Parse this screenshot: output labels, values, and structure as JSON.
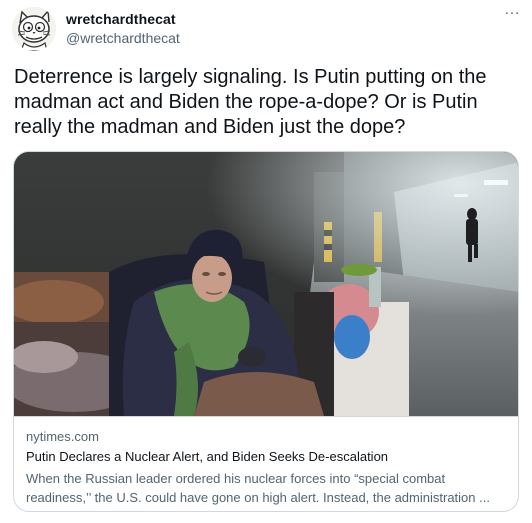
{
  "author": {
    "display_name": "wretchardthecat",
    "handle": "@wretchardthecat",
    "avatar_icon": "cartoon-cat-avatar"
  },
  "menu": {
    "more_label": "···",
    "icon": "more-horizontal-icon"
  },
  "tweet": {
    "text": "Deterrence is largely signaling. Is Putin putting on the madman act and Biden the rope-a-dope? Or is Putin really the madman and Biden just the dope?"
  },
  "link_card": {
    "domain": "nytimes.com",
    "title": "Putin Declares a Nuclear Alert, and Biden Seeks De-escalation",
    "description": "When the Russian leader ordered his nuclear forces into “special combat readiness,’’ the U.S. could have gone on high alert. Instead, the administration ..."
  },
  "colors": {
    "text_primary": "#0f1419",
    "text_secondary": "#536471",
    "border": "#cfd9de",
    "background": "#ffffff"
  }
}
